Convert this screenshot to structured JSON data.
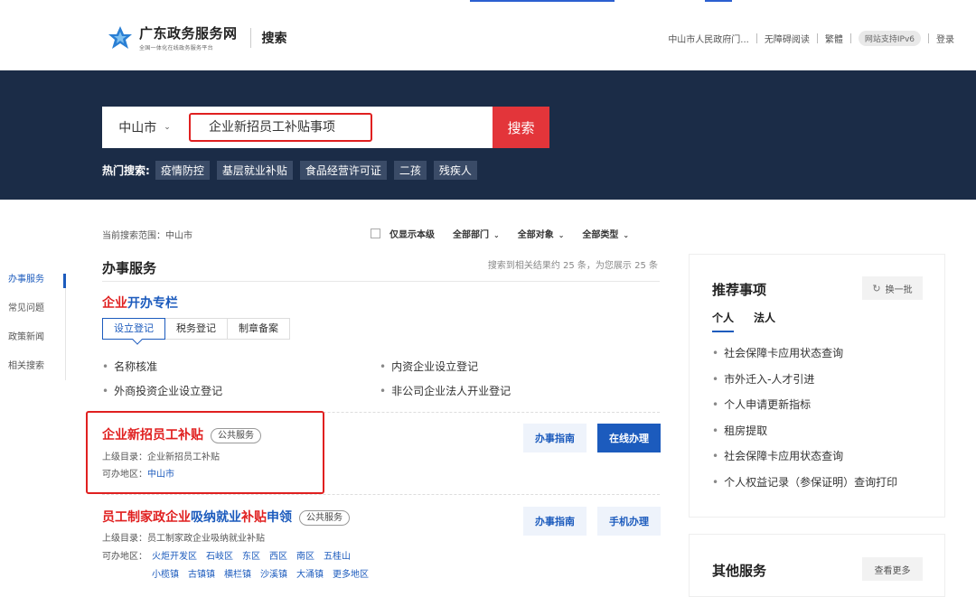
{
  "header": {
    "logo_title": "广东政务服务网",
    "logo_sub": "全国一体化在线政务服务平台",
    "page_title": "搜索",
    "links": [
      "中山市人民政府门...",
      "无障碍阅读",
      "繁體",
      "网站支持IPv6",
      "登录"
    ]
  },
  "search": {
    "city": "中山市",
    "query": "企业新招员工补贴事项",
    "button": "搜索",
    "hot_label": "热门搜索:",
    "hot_tags": [
      "疫情防控",
      "基层就业补贴",
      "食品经营许可证",
      "二孩",
      "残疾人"
    ]
  },
  "filters": {
    "scope": "当前搜索范围：中山市",
    "only_this_level": "仅显示本级",
    "dept": "全部部门",
    "target": "全部对象",
    "type": "全部类型"
  },
  "sidenav": [
    "办事服务",
    "常见问题",
    "政策新闻",
    "相关搜索"
  ],
  "main": {
    "section_title": "办事服务",
    "result_count": "搜索到相关结果约 25 条，为您展示 25 条",
    "kaiban": {
      "title_red": "企业",
      "title_blue": "开办专栏",
      "tabs": [
        "设立登记",
        "税务登记",
        "制章备案"
      ],
      "items": [
        "名称核准",
        "内资企业设立登记",
        "外商投资企业设立登记",
        "非公司企业法人开业登记"
      ]
    },
    "results": [
      {
        "title": "企业新招员工补贴",
        "badge": "公共服务",
        "parent_label": "上级目录：",
        "parent": "企业新招员工补贴",
        "area_label": "可办地区：",
        "area": "中山市",
        "guide": "办事指南",
        "action": "在线办理"
      },
      {
        "title_parts": [
          "员工",
          "制家政",
          "企业",
          "吸纳就业",
          "补贴",
          "申领"
        ],
        "badge": "公共服务",
        "parent_label": "上级目录：",
        "parent": "员工制家政企业吸纳就业补贴",
        "area_label": "可办地区：",
        "areas_row1": [
          "火炬开发区",
          "石岐区",
          "东区",
          "西区",
          "南区",
          "五桂山"
        ],
        "areas_row2": [
          "小榄镇",
          "古镇镇",
          "横栏镇",
          "沙溪镇",
          "大涌镇",
          "更多地区"
        ],
        "guide": "办事指南",
        "action": "手机办理"
      }
    ]
  },
  "recommend": {
    "title": "推荐事项",
    "refresh": "换一批",
    "tabs": [
      "个人",
      "法人"
    ],
    "items": [
      "社会保障卡应用状态查询",
      "市外迁入-人才引进",
      "个人申请更新指标",
      "租房提取",
      "社会保障卡应用状态查询",
      "个人权益记录（参保证明）查询打印"
    ]
  },
  "other": {
    "title": "其他服务",
    "more": "查看更多"
  },
  "colors": {
    "banner": "#1b2c47",
    "accent_blue": "#1c5bbd",
    "accent_red": "#e02020",
    "search_button": "#e3353a"
  }
}
